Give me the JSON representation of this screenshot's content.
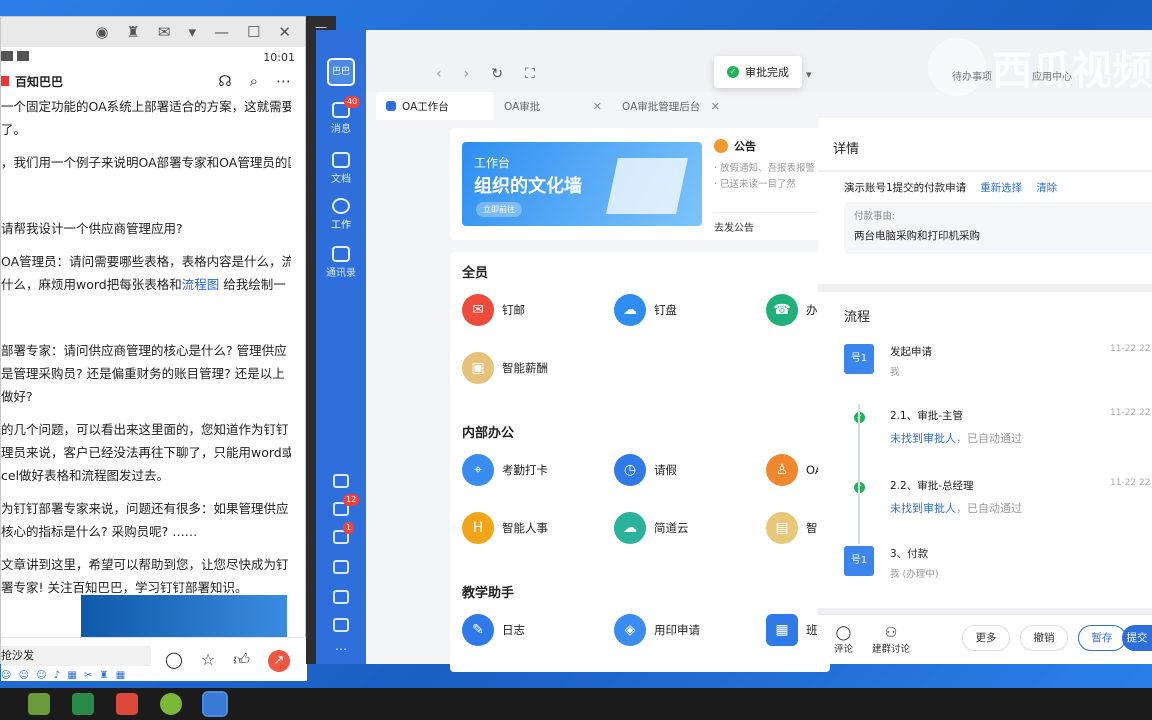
{
  "phone": {
    "time": "10:01",
    "account": "百知巴巴",
    "paragraphs": [
      "一个固定功能的OA系统上部署适合的方案，这就需要",
      "了。",
      "，我们用一个例子来说明OA部署专家和OA管理员的区",
      "",
      "  请帮我设计一个供应商管理应用?",
      "OA管理员：请问需要哪些表格，表格内容是什么，流",
      "什么，麻烦用word把每张表格和",
      "",
      "部署专家：请问供应商管理的核心是什么? 管理供应",
      "是管理采购员? 还是偏重财务的账目管理? 还是以上",
      "做好?",
      "的几个问题，可以看出来这里面的，您知道作为钉钉",
      "理员来说，客户已经没法再往下聊了，只能用word或",
      "cel做好表格和流程图发过去。",
      "为钉钉部署专家来说，问题还有很多：如果管理供应",
      "核心的指标是什么? 采购员呢? ……",
      "文章讲到这里，希望可以帮助到您，让您尽快成为钉",
      "署专家! 关注百知巴巴，学习钉钉部署知识。"
    ],
    "link_text": "流程图",
    "link_tail": " 给我绘制一",
    "comment_placeholder": "抢沙发"
  },
  "sidebar": {
    "avatar": "巴巴",
    "items": [
      {
        "label": "消息",
        "badge": "40"
      },
      {
        "label": "文档",
        "badge": ""
      },
      {
        "label": "工作",
        "badge": ""
      },
      {
        "label": "通讯录",
        "badge": ""
      }
    ],
    "bottom_badges": {
      "todo": "12",
      "ding": "1"
    }
  },
  "toast": {
    "text": "审批完成"
  },
  "tabs": [
    {
      "label": "OA工作台",
      "active": true
    },
    {
      "label": "OA审批",
      "active": false
    },
    {
      "label": "OA审批管理后台",
      "active": false
    }
  ],
  "banner": {
    "line1": "工作台",
    "line2": "组织的文化墙",
    "button": "立即前往"
  },
  "notice": {
    "title": "公告",
    "items": [
      "· 放假通知、吾报表报警",
      "· 已送未读一目了然"
    ],
    "publish": "去发公告"
  },
  "sections": [
    {
      "title": "全员",
      "apps": [
        "钉邮",
        "钉盘",
        "办公",
        "智能薪酬"
      ]
    },
    {
      "title": "内部办公",
      "apps": [
        "考勤打卡",
        "请假",
        "OA",
        "智能人事",
        "简道云",
        "智能"
      ]
    },
    {
      "title": "教学助手",
      "apps": [
        "日志",
        "用印申请",
        "班级"
      ]
    }
  ],
  "detail": {
    "title": "详情",
    "applicant_line": "演示账号1提交的付款申请",
    "reselect": "重新选择",
    "clear": "清除",
    "reason_label": "付款事由:",
    "reason_value": "两台电脑采购和打印机采购",
    "flow_title": "流程",
    "steps": [
      {
        "avatar": "号1",
        "title": "发起申请",
        "sub": "我",
        "time": "11-22 22"
      },
      {
        "title": "2.1、审批-主管",
        "link": "未找到审批人",
        "tail": "，已自动通过",
        "time": "11-22 22"
      },
      {
        "title": "2.2、审批-总经理",
        "link": "未找到审批人",
        "tail": "，已自动通过",
        "time": "11-22 22"
      },
      {
        "avatar": "号1",
        "title": "3、付款",
        "sub": "我 (办理中)",
        "time": ""
      }
    ],
    "footer": {
      "comment": "评论",
      "group": "建群讨论",
      "more": "更多",
      "revoke": "撤销",
      "save": "暂存",
      "submit": "提交"
    }
  },
  "watermark": {
    "text": "西瓜视频",
    "small1": "待办事项",
    "small2": "应用中心"
  }
}
